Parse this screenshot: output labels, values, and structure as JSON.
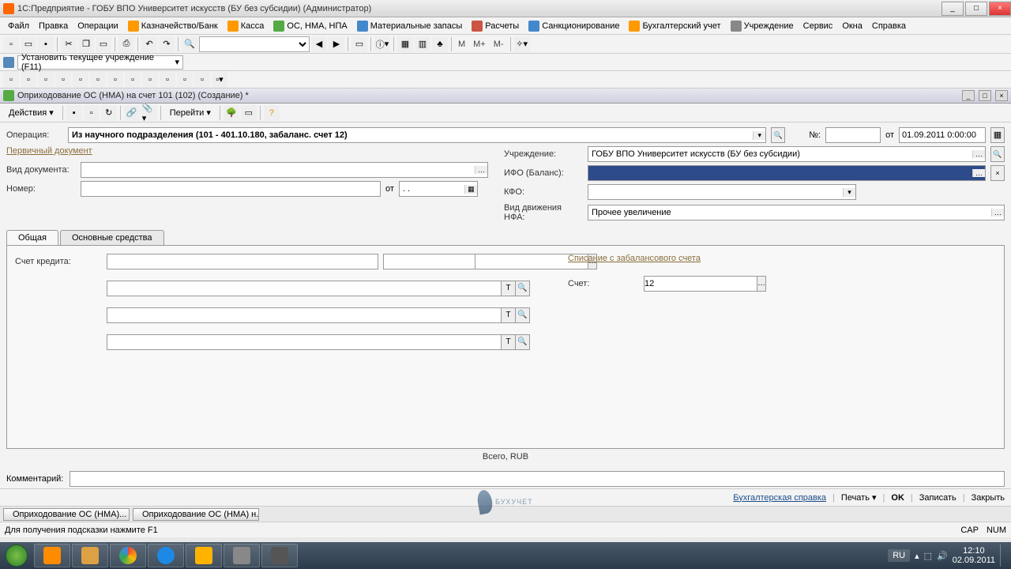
{
  "window": {
    "title": "1С:Предприятие - ГОБУ ВПО Университет искусств (БУ без субсидии) (Администратор)"
  },
  "menubar": {
    "items": [
      "Файл",
      "Правка",
      "Операции",
      "Казначейство/Банк",
      "Касса",
      "ОС, НМА, НПА",
      "Материальные запасы",
      "Расчеты",
      "Санкционирование",
      "Бухгалтерский учет",
      "Учреждение",
      "Сервис",
      "Окна",
      "Справка"
    ]
  },
  "toolbar2_text": [
    "M",
    "M+",
    "M-"
  ],
  "row3": {
    "label": "Установить текущее учреждение (F11)"
  },
  "doc": {
    "title": "Оприходование ОС (НМА) на счет 101 (102) (Создание) *",
    "actions_label": "Действия",
    "goto_label": "Перейти"
  },
  "form": {
    "operation_label": "Операция:",
    "operation_value": "Из научного подразделения (101 - 401.10.180, забаланс. счет 12)",
    "num_label": "№:",
    "num_value": "",
    "from_label": "от",
    "date_value": "01.09.2011 0:00:00",
    "primary_doc_label": "Первичный документ",
    "doc_type_label": "Вид документа:",
    "doc_type_value": "",
    "doc_num_label": "Номер:",
    "inst_label": "Учреждение:",
    "inst_value": "ГОБУ ВПО Университет искусств (БУ без субсидии)",
    "ifo_label": "ИФО (Баланс):",
    "ifo_value": "",
    "kfo_label": "КФО:",
    "kfo_value": "",
    "nfa_label": "Вид движения НФА:",
    "nfa_value": "Прочее увеличение"
  },
  "tabs": {
    "tab1": "Общая",
    "tab2": "Основные средства"
  },
  "tabbody": {
    "credit_label": "Счет кредита:",
    "writeoff_label": "Списание с забалансового счета",
    "acct_label": "Счет:",
    "acct_value": "12"
  },
  "total_label": "Всего, RUB",
  "comment_label": "Комментарий:",
  "footer": {
    "ref": "Бухгалтерская справка",
    "print": "Печать",
    "ok": "OK",
    "save": "Записать",
    "close": "Закрыть"
  },
  "bottom_tabs": {
    "t1": "Оприходование ОС (НМА)...",
    "t2": "Оприходование ОС (НМА) н..."
  },
  "statusbar": {
    "hint": "Для получения подсказки нажмите F1",
    "cap": "CAP",
    "num": "NUM"
  },
  "tray": {
    "lang": "RU",
    "time": "12:10",
    "date": "02.09.2011"
  },
  "watermark": "БУХУЧЕТ"
}
